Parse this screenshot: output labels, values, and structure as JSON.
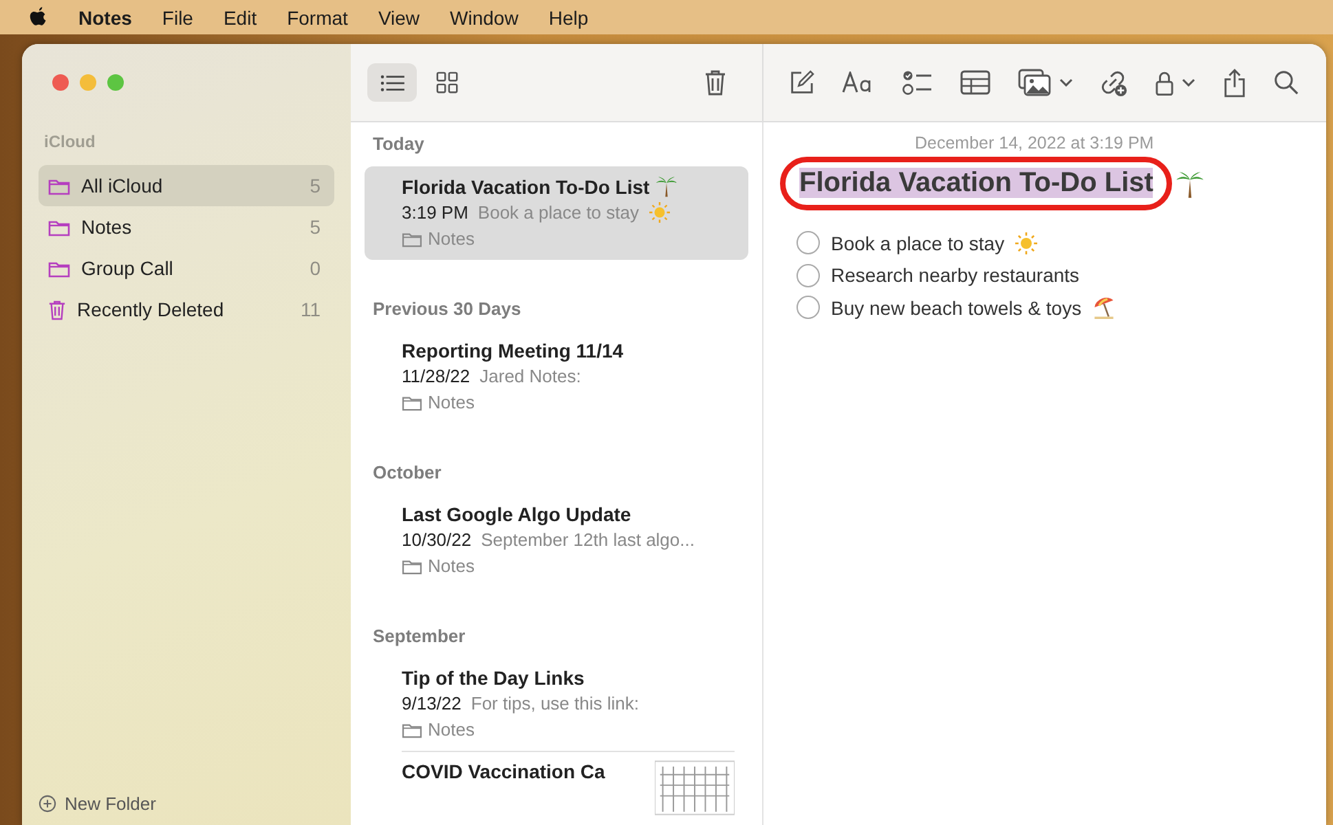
{
  "menu_bar": {
    "app": "Notes",
    "items": [
      "File",
      "Edit",
      "Format",
      "View",
      "Window",
      "Help"
    ]
  },
  "sidebar": {
    "section": "iCloud",
    "folders": [
      {
        "kind": "folder",
        "label": "All iCloud",
        "count": "5",
        "selected": true
      },
      {
        "kind": "folder",
        "label": "Notes",
        "count": "5",
        "selected": false
      },
      {
        "kind": "folder",
        "label": "Group Call",
        "count": "0",
        "selected": false
      },
      {
        "kind": "trash",
        "label": "Recently Deleted",
        "count": "11",
        "selected": false
      }
    ],
    "new_folder": "New Folder"
  },
  "toolbar": {
    "view_modes": [
      {
        "kind": "list",
        "selected": true
      },
      {
        "kind": "grid",
        "selected": false
      }
    ]
  },
  "note_list": [
    {
      "heading": "Today",
      "notes": [
        {
          "title": "Florida Vacation To-Do List",
          "title_icon": {
            "kind": "palm"
          },
          "date": "3:19 PM",
          "preview": "Book a place to stay",
          "preview_icon": {
            "kind": "sun"
          },
          "folder": "Notes",
          "selected": true
        }
      ]
    },
    {
      "heading": "Previous 30 Days",
      "notes": [
        {
          "title": "Reporting Meeting 11/14",
          "date": "11/28/22",
          "preview": "Jared Notes:",
          "folder": "Notes",
          "selected": false
        }
      ]
    },
    {
      "heading": "October",
      "notes": [
        {
          "title": "Last Google Algo Update",
          "date": "10/30/22",
          "preview": "September 12th last algo...",
          "folder": "Notes",
          "selected": false
        }
      ]
    },
    {
      "heading": "September",
      "notes": [
        {
          "title": "Tip of the Day Links",
          "date": "9/13/22",
          "preview": "For tips, use this link:",
          "folder": "Notes",
          "selected": false
        },
        {
          "title": "COVID Vaccination Ca",
          "thumbnail": true,
          "selected": false
        }
      ]
    }
  ],
  "editor": {
    "timestamp": "December 14, 2022 at 3:19 PM",
    "title": "Florida Vacation To-Do List",
    "title_icon": {
      "kind": "palm"
    },
    "title_selected": true,
    "title_circled": true,
    "checklist": [
      {
        "text": "Book a place to stay",
        "icon": {
          "kind": "sun"
        },
        "checked": false
      },
      {
        "text": "Research nearby restaurants",
        "checked": false
      },
      {
        "text": "Buy new beach towels & toys",
        "icon": {
          "kind": "umbrella"
        },
        "checked": false
      }
    ]
  }
}
